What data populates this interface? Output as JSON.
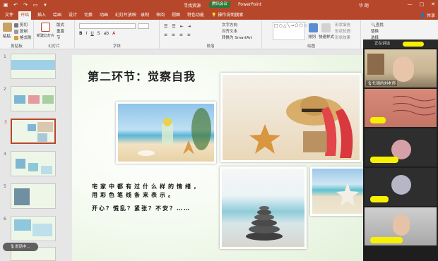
{
  "titlebar": {
    "document": "寻找资源",
    "meeting_badge": "腾讯会议",
    "app_name": "PowerPoint",
    "user": "华 朗",
    "window_buttons": [
      "—",
      "□",
      "✕"
    ]
  },
  "tabs": [
    {
      "label": "文件",
      "active": false
    },
    {
      "label": "开始",
      "active": true
    },
    {
      "label": "插入",
      "active": false
    },
    {
      "label": "绘画",
      "active": false
    },
    {
      "label": "设计",
      "active": false
    },
    {
      "label": "切换",
      "active": false
    },
    {
      "label": "动画",
      "active": false
    },
    {
      "label": "幻灯片放映",
      "active": false
    },
    {
      "label": "录制",
      "active": false
    },
    {
      "label": "审阅",
      "active": false
    },
    {
      "label": "视图",
      "active": false
    },
    {
      "label": "特色功能",
      "active": false
    },
    {
      "label": "操作说明搜索",
      "active": false
    }
  ],
  "share_label": "共享",
  "ribbon": {
    "clipboard": {
      "paste": "粘贴",
      "cut": "剪切",
      "copy": "复制",
      "format": "格式刷",
      "label": "剪贴板"
    },
    "slides": {
      "new": "新建幻灯片",
      "layout": "版式",
      "reset": "重置",
      "section": "节",
      "label": "幻灯片"
    },
    "font_label": "字体",
    "paragraph": {
      "text_dir": "文字方向",
      "align": "对齐文本",
      "smartart": "转换为 SmartArt",
      "label": "段落"
    },
    "drawing": {
      "arrange": "排列",
      "quick_styles": "快速样式",
      "fill": "形状填充",
      "outline": "形状轮廓",
      "effects": "形状效果",
      "label": "绘图"
    },
    "editing": {
      "find": "查找",
      "replace": "替换",
      "select": "选择"
    }
  },
  "thumbnails": [
    "1",
    "2",
    "3",
    "4",
    "5",
    "6"
  ],
  "mini_bar_label": "说话中...",
  "slide": {
    "title": "第二环节：觉察自我",
    "line1": "宅家中都有过什么样的情绪，",
    "line2": "用彩色笔线条来表示。",
    "line3": "开心？慌乱？紧张？不安？……"
  },
  "meeting": {
    "speaking": "正在讲话",
    "participant_main": "忙碌的刘老师"
  },
  "colors": {
    "brand": "#b7472a",
    "ribbon": "#f3f3f3",
    "highlight_name": "#f7f000"
  }
}
